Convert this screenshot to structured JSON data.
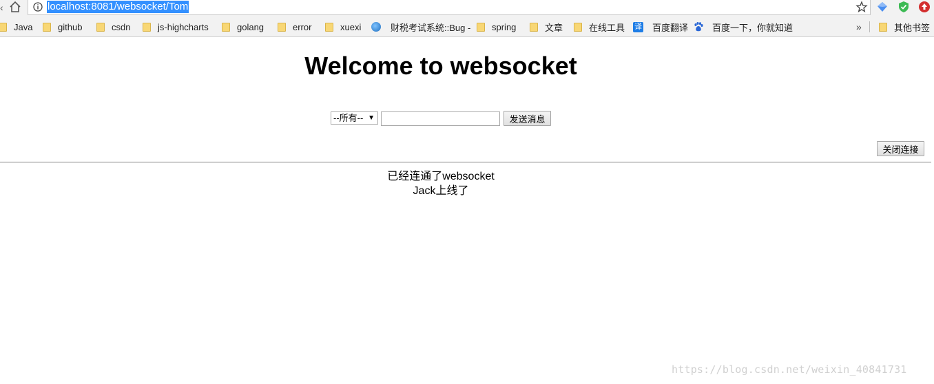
{
  "browser": {
    "url": "localhost:8081/websocket/Tom",
    "bookmarks": [
      {
        "label": "Java",
        "icon": "folder-icon"
      },
      {
        "label": "github",
        "icon": "folder-icon"
      },
      {
        "label": "csdn",
        "icon": "folder-icon"
      },
      {
        "label": "js-highcharts",
        "icon": "folder-icon"
      },
      {
        "label": "golang",
        "icon": "folder-icon"
      },
      {
        "label": "error",
        "icon": "folder-icon"
      },
      {
        "label": "xuexi",
        "icon": "folder-icon"
      },
      {
        "label": "财税考试系统::Bug -",
        "icon": "globe-icon"
      },
      {
        "label": "spring",
        "icon": "folder-icon"
      },
      {
        "label": "文章",
        "icon": "folder-icon"
      },
      {
        "label": "在线工具",
        "icon": "folder-icon"
      },
      {
        "label": "百度翻译",
        "icon": "translate-icon",
        "icon_text": "译"
      },
      {
        "label": "百度一下，你就知道",
        "icon": "baidu-paw-icon"
      },
      {
        "label": "其他书签",
        "icon": "folder-icon"
      }
    ],
    "more_glyph": "»"
  },
  "page": {
    "title": "Welcome to websocket",
    "scope_select": {
      "selected": "--所有--"
    },
    "message_input": {
      "value": ""
    },
    "send_label": "发送消息",
    "close_label": "关闭连接",
    "messages": [
      "已经连通了websocket",
      "Jack上线了"
    ]
  },
  "watermark": "https://blog.csdn.net/weixin_40841731",
  "colors": {
    "url_highlight": "#3390ff",
    "folder": "#f8d775"
  }
}
